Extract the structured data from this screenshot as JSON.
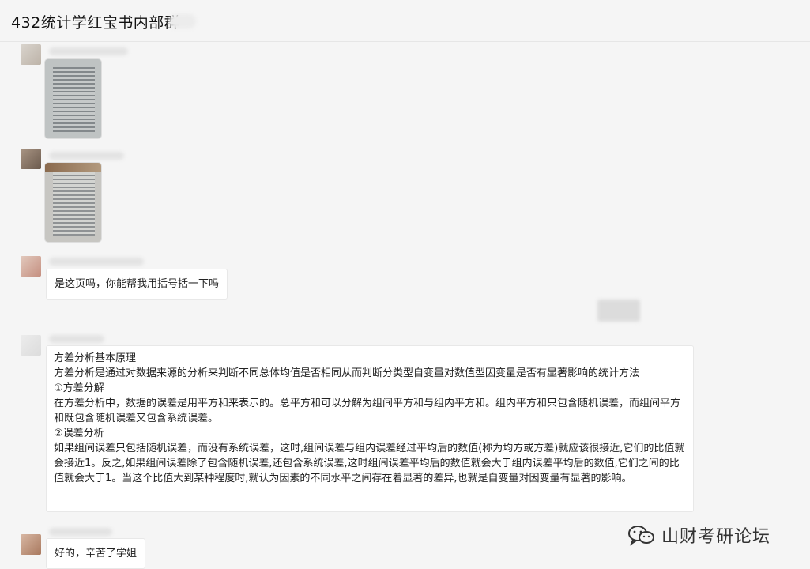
{
  "chat": {
    "title": "432统计学红宝书内部群"
  },
  "messages": {
    "m3_text": "是这页吗，你能帮我用括号括一下吗",
    "m4_lines": [
      "方差分析基本原理",
      "方差分析是通过对数据来源的分析来判断不同总体均值是否相同从而判断分类型自变量对数值型因变量是否有显著影响的统计方法",
      "①方差分解",
      "在方差分析中，数据的误差是用平方和来表示的。总平方和可以分解为组间平方和与组内平方和。组内平方和只包含随机误差，而组间平方和既包含随机误差又包含系统误差。",
      "②误差分析",
      "如果组间误差只包括随机误差，而没有系统误差，这时,组间误差与组内误差经过平均后的数值(称为均方或方差)就应该很接近,它们的比值就会接近1。反之,如果组间误差除了包含随机误差,还包含系统误差,这时组间误差平均后的数值就会大于组内误差平均后的数值,它们之间的比值就会大于1。当这个比值大到某种程度时,就认为因素的不同水平之间存在着显著的差异,也就是自变量对因变量有显著的影响。"
    ],
    "m5_text": "好的，辛苦了学姐"
  },
  "watermark": {
    "text": "山财考研论坛",
    "icon": "wechat-icon"
  },
  "colors": {
    "background": "#f5f5f5",
    "bubble": "#ffffff",
    "header_divider": "#e6e6e6"
  }
}
